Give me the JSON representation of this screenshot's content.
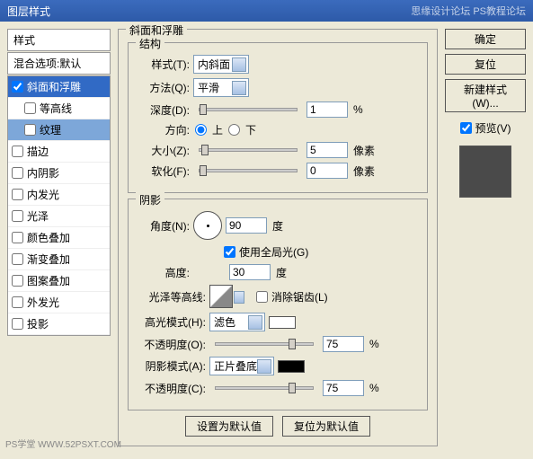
{
  "title": "图层样式",
  "watermark_right": "思缘设计论坛  PS教程论坛",
  "left": {
    "header": "样式",
    "blend": "混合选项:默认",
    "items": [
      {
        "label": "斜面和浮雕",
        "checked": true,
        "selected": true,
        "sub": false
      },
      {
        "label": "等高线",
        "checked": false,
        "selected": false,
        "sub": true
      },
      {
        "label": "纹理",
        "checked": false,
        "selected": true,
        "sub": true
      },
      {
        "label": "描边",
        "checked": false,
        "selected": false,
        "sub": false
      },
      {
        "label": "内阴影",
        "checked": false,
        "selected": false,
        "sub": false
      },
      {
        "label": "内发光",
        "checked": false,
        "selected": false,
        "sub": false
      },
      {
        "label": "光泽",
        "checked": false,
        "selected": false,
        "sub": false
      },
      {
        "label": "颜色叠加",
        "checked": false,
        "selected": false,
        "sub": false
      },
      {
        "label": "渐变叠加",
        "checked": false,
        "selected": false,
        "sub": false
      },
      {
        "label": "图案叠加",
        "checked": false,
        "selected": false,
        "sub": false
      },
      {
        "label": "外发光",
        "checked": false,
        "selected": false,
        "sub": false
      },
      {
        "label": "投影",
        "checked": false,
        "selected": false,
        "sub": false
      }
    ]
  },
  "main": {
    "title": "斜面和浮雕",
    "structure": {
      "legend": "结构",
      "style_label": "样式(T):",
      "style_value": "内斜面",
      "method_label": "方法(Q):",
      "method_value": "平滑",
      "depth_label": "深度(D):",
      "depth_value": "1",
      "depth_unit": "%",
      "direction_label": "方向:",
      "up": "上",
      "down": "下",
      "size_label": "大小(Z):",
      "size_value": "5",
      "size_unit": "像素",
      "soften_label": "软化(F):",
      "soften_value": "0",
      "soften_unit": "像素"
    },
    "shading": {
      "legend": "阴影",
      "angle_label": "角度(N):",
      "angle_value": "90",
      "angle_unit": "度",
      "global_light": "使用全局光(G)",
      "altitude_label": "高度:",
      "altitude_value": "30",
      "altitude_unit": "度",
      "contour_label": "光泽等高线:",
      "antialias": "消除锯齿(L)",
      "highlight_mode_label": "高光模式(H):",
      "highlight_mode_value": "滤色",
      "highlight_opacity_label": "不透明度(O):",
      "highlight_opacity_value": "75",
      "highlight_opacity_unit": "%",
      "shadow_mode_label": "阴影模式(A):",
      "shadow_mode_value": "正片叠底",
      "shadow_opacity_label": "不透明度(C):",
      "shadow_opacity_value": "75",
      "shadow_opacity_unit": "%"
    },
    "buttons": {
      "default": "设置为默认值",
      "reset": "复位为默认值"
    }
  },
  "right": {
    "ok": "确定",
    "cancel": "复位",
    "new_style": "新建样式(W)...",
    "preview": "预览(V)"
  },
  "footer_wm": "PS学堂  WWW.52PSXT.COM"
}
